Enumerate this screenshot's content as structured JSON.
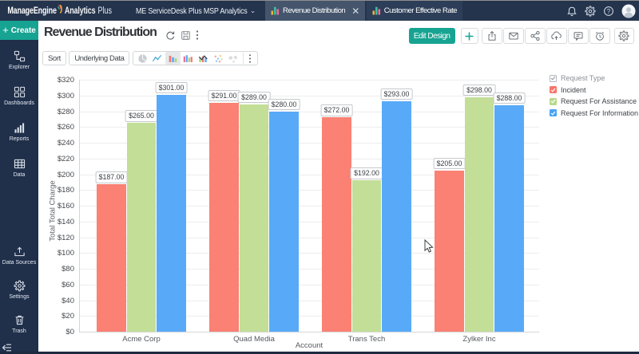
{
  "header": {
    "brand": {
      "part1": "ManageEngine",
      "part2": "Analytics",
      "part3": "Plus"
    },
    "workspace": "ME ServiceDesk Plus MSP Analytics",
    "right_icons": [
      "notifications-bell-icon",
      "admin-gear-icon",
      "help-icon",
      "user-avatar"
    ],
    "tabs": [
      {
        "label": "Revenue Distribution",
        "active": true,
        "closable": true
      },
      {
        "label": "Customer Effective Rate",
        "active": false,
        "closable": false
      }
    ]
  },
  "sidebar": {
    "create_label": "Create",
    "items_top": [
      {
        "label": "Explorer",
        "icon": "explorer-icon"
      },
      {
        "label": "Dashboards",
        "icon": "dashboards-icon"
      },
      {
        "label": "Reports",
        "icon": "reports-icon"
      },
      {
        "label": "Data",
        "icon": "data-icon"
      }
    ],
    "items_bottom": [
      {
        "label": "Data Sources",
        "icon": "data-sources-icon"
      },
      {
        "label": "Settings",
        "icon": "settings-icon"
      },
      {
        "label": "Trash",
        "icon": "trash-icon"
      }
    ]
  },
  "main": {
    "title": "Revenue Distribution",
    "title_icons": [
      "refresh-icon",
      "save-snapshot-icon",
      "more-kebab-icon"
    ],
    "edit_design_label": "Edit Design",
    "action_icons": [
      "plus-icon",
      "export-icon",
      "envelope-icon",
      "share-nodes-icon",
      "cloud-upload-icon",
      "comment-icon",
      "alarm-clock-icon",
      "gear-icon"
    ],
    "sort_label": "Sort",
    "underlying_data_label": "Underlying Data",
    "chart_type_icons": [
      "pie",
      "line",
      "bar",
      "column",
      "combo",
      "scatter",
      "map",
      "more-kebab"
    ],
    "selected_chart_type": "bar"
  },
  "chart_data": {
    "type": "bar",
    "title": "Revenue Distribution",
    "categories": [
      "Acme Corp",
      "Quad Media",
      "Trans Tech",
      "Zylker Inc"
    ],
    "series": [
      {
        "name": "Incident",
        "color": "#fa8173",
        "values": [
          187,
          291,
          272,
          205
        ]
      },
      {
        "name": "Request For Assistance",
        "color": "#c3de97",
        "values": [
          265,
          289,
          192,
          298
        ]
      },
      {
        "name": "Request For Information",
        "color": "#58aaf8",
        "values": [
          301,
          280,
          293,
          288
        ]
      }
    ],
    "legend": {
      "title": "Request Type",
      "position": "top-right",
      "items": [
        {
          "label": "Incident",
          "color": "#f9756b",
          "checked": true
        },
        {
          "label": "Request For Assistance",
          "color": "#b7da8b",
          "checked": true
        },
        {
          "label": "Request For Information",
          "color": "#47a4f4",
          "checked": true
        }
      ]
    },
    "xlabel": "Account",
    "ylabel": "Total Total Charge",
    "ylim": [
      0,
      320
    ],
    "ytick_step": 20,
    "ytick_prefix": "$",
    "value_prefix": "$",
    "value_decimals": 2,
    "grid": true
  }
}
